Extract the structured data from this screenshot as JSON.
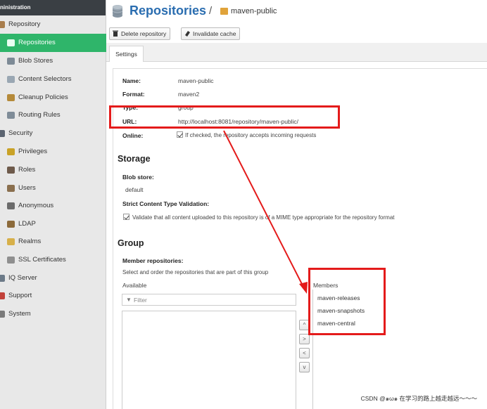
{
  "sidebar": {
    "header": "ninistration",
    "items": [
      {
        "label": "Repository",
        "icon": "folder-icon",
        "indent": false,
        "active": false
      },
      {
        "label": "Repositories",
        "icon": "database-icon",
        "indent": true,
        "active": true
      },
      {
        "label": "Blob Stores",
        "icon": "blobstore-icon",
        "indent": true,
        "active": false
      },
      {
        "label": "Content Selectors",
        "icon": "selector-icon",
        "indent": true,
        "active": false
      },
      {
        "label": "Cleanup Policies",
        "icon": "broom-icon",
        "indent": true,
        "active": false
      },
      {
        "label": "Routing Rules",
        "icon": "routing-icon",
        "indent": true,
        "active": false
      },
      {
        "label": "Security",
        "icon": "security-icon",
        "indent": false,
        "active": false
      },
      {
        "label": "Privileges",
        "icon": "badge-icon",
        "indent": true,
        "active": false
      },
      {
        "label": "Roles",
        "icon": "role-icon",
        "indent": true,
        "active": false
      },
      {
        "label": "Users",
        "icon": "users-icon",
        "indent": true,
        "active": false
      },
      {
        "label": "Anonymous",
        "icon": "user-icon",
        "indent": true,
        "active": false
      },
      {
        "label": "LDAP",
        "icon": "book-icon",
        "indent": true,
        "active": false
      },
      {
        "label": "Realms",
        "icon": "realm-icon",
        "indent": true,
        "active": false
      },
      {
        "label": "SSL Certificates",
        "icon": "certificate-icon",
        "indent": true,
        "active": false
      },
      {
        "label": "IQ Server",
        "icon": "iq-server-icon",
        "indent": false,
        "active": false
      },
      {
        "label": "Support",
        "icon": "support-icon",
        "indent": false,
        "active": false
      },
      {
        "label": "System",
        "icon": "gear-icon",
        "indent": false,
        "active": false
      }
    ]
  },
  "header": {
    "title": "Repositories",
    "separator": "/",
    "crumb": "maven-public"
  },
  "toolbar": {
    "delete_label": "Delete repository",
    "invalidate_label": "Invalidate cache"
  },
  "tabs": {
    "settings": "Settings"
  },
  "form": {
    "name_label": "Name:",
    "name_value": "maven-public",
    "format_label": "Format:",
    "format_value": "maven2",
    "type_label": "Type:",
    "type_value": "group",
    "url_label": "URL:",
    "url_value": "http://localhost:8081/repository/maven-public/",
    "online_label": "Online:",
    "online_text": "If checked, the repository accepts incoming requests"
  },
  "storage": {
    "heading": "Storage",
    "blob_label": "Blob store:",
    "blob_value": "default",
    "strict_label": "Strict Content Type Validation:",
    "strict_text": "Validate that all content uploaded to this repository is of a MIME type appropriate for the repository format"
  },
  "group": {
    "heading": "Group",
    "members_label": "Member repositories:",
    "members_help": "Select and order the repositories that are part of this group",
    "available_label": "Available",
    "members_header": "Members",
    "filter_placeholder": "Filter",
    "members": [
      "maven-releases",
      "maven-snapshots",
      "maven-central"
    ],
    "arrows": [
      "^",
      ">",
      "<",
      "v"
    ]
  },
  "colors": {
    "accent": "#2a6db0",
    "active": "#2fb56a",
    "annotation": "#e41b1b"
  },
  "watermark": "CSDN @๑ω๑ 在学习的路上越走越远～～～"
}
